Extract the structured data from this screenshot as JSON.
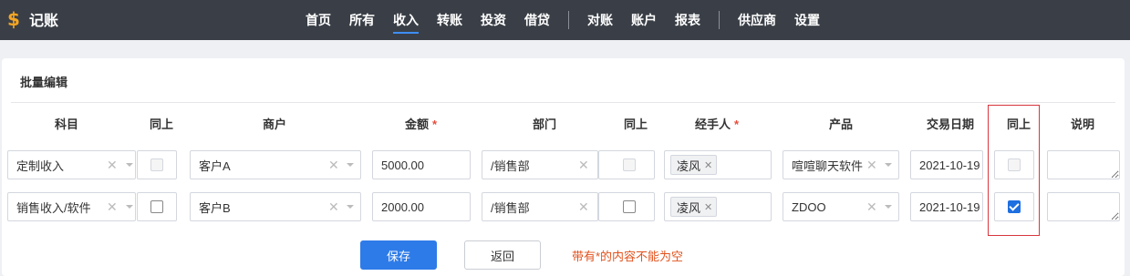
{
  "app": {
    "logo_glyph": "$",
    "title": "记账"
  },
  "nav": {
    "items": [
      "首页",
      "所有",
      "收入",
      "转账",
      "投资",
      "借贷",
      "对账",
      "账户",
      "报表",
      "供应商",
      "设置"
    ],
    "active": "收入"
  },
  "form": {
    "title": "批量编辑",
    "headers": {
      "subject": "科目",
      "same1": "同上",
      "merchant": "商户",
      "amount": "金额",
      "dept": "部门",
      "same2": "同上",
      "handler": "经手人",
      "product": "产品",
      "date": "交易日期",
      "same3": "同上",
      "note": "说明"
    },
    "required_mark": "*",
    "rows": [
      {
        "subject": "定制收入",
        "merchant": "客户A",
        "amount": "5000.00",
        "dept": "/销售部",
        "handler": "凌风",
        "product": "喧喧聊天软件",
        "date": "2021-10-19",
        "same_dept": false,
        "same_date": false,
        "note": ""
      },
      {
        "subject": "销售收入/软件",
        "merchant": "客户B",
        "amount": "2000.00",
        "dept": "/销售部",
        "handler": "凌风",
        "product": "ZDOO",
        "date": "2021-10-19",
        "same_dept": false,
        "same_date": true,
        "note": ""
      }
    ],
    "save_label": "保存",
    "back_label": "返回",
    "hint": "带有*的内容不能为空"
  },
  "colors": {
    "topbar": "#3a3f47",
    "primary": "#2d7be8",
    "highlight": "#d9363e",
    "hint": "#e2521d",
    "required": "#e74c3c"
  }
}
